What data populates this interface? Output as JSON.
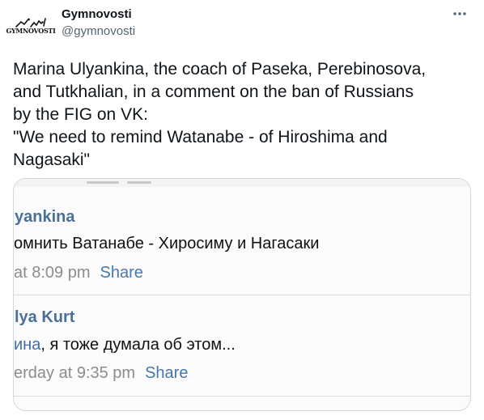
{
  "account": {
    "display_name": "Gymnovosti",
    "handle": "@gymnovosti",
    "avatar_text": "GYMNOVOSTI"
  },
  "tweet": {
    "lines": [
      "Marina Ulyankina, the coach of Paseka, Perebinosova,",
      "and Tutkhalian, in a comment on the ban of Russians",
      "by the FIG on VK:",
      "\"We need to remind Watanabe - of Hiroshima and",
      "Nagasaki\""
    ]
  },
  "icons": {
    "more": "more-horizontal-icon",
    "avatar": "gymnast-logo-icon"
  },
  "screenshot": {
    "comments": [
      {
        "author": "yankina",
        "text": "омнить Ватанабе - Хиросиму и Нагасаки",
        "text_highlight": "",
        "time": "at 8:09 pm",
        "share": "Share"
      },
      {
        "author": "lya Kurt",
        "text_highlight": "ина",
        "text": ", я тоже думала об этом...",
        "time": "erday at 9:35 pm",
        "share": "Share"
      }
    ]
  },
  "colors": {
    "text_primary": "#0f1419",
    "text_secondary": "#536471",
    "vk_link": "#4a76a8",
    "border": "#cfd9de"
  }
}
